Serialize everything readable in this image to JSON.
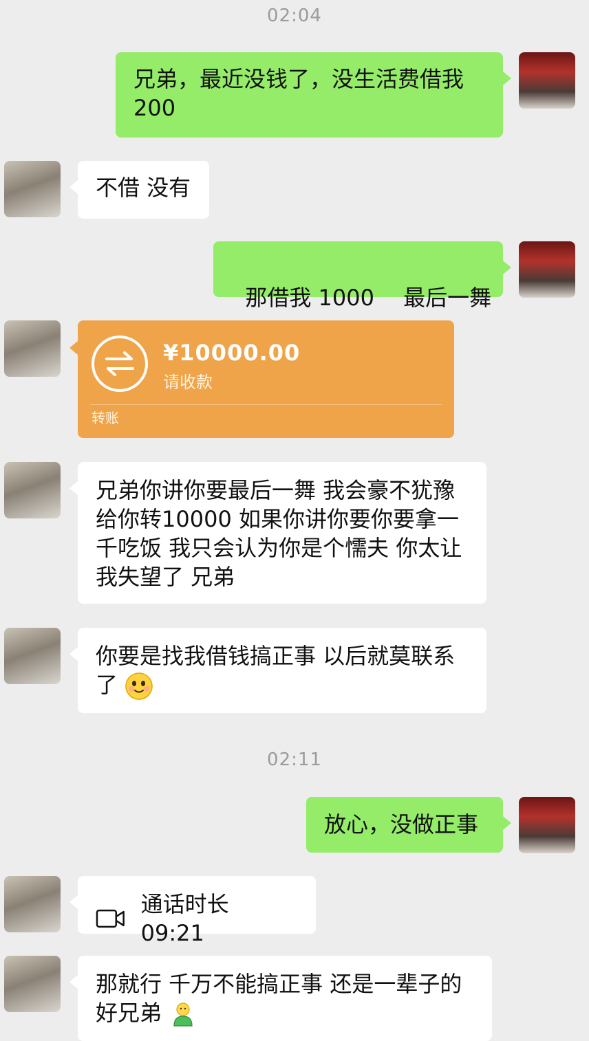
{
  "timestamps": [
    "02:04",
    "02:11"
  ],
  "messages": {
    "m1": "兄弟，最近没钱了，没生活费借我200",
    "m2": "不借 没有",
    "m3": "那借我 1000　 最后一舞",
    "transfer": {
      "amount": "¥10000.00",
      "status": "请收款",
      "label": "转账"
    },
    "m5": "兄弟你讲你要最后一舞 我会豪不犹豫给你转10000 如果你讲你要你要拿一千吃饭 我只会认为你是个懦夫 你太让我失望了 兄弟",
    "m6": "你要是找我借钱搞正事 以后就莫联系了",
    "m7": "放心，没做正事",
    "call": "通话时长 09:21",
    "m9": "那就行 千万不能搞正事 还是一辈子的好兄弟"
  },
  "icons": {
    "transfer": "transfer-arrows-icon",
    "call": "video-call-icon",
    "emoji1": "smiling-face-emoji",
    "emoji2": "green-figure-emoji"
  },
  "colors": {
    "me_bubble": "#95ec69",
    "friend_bubble": "#ffffff",
    "transfer": "#f0a44a",
    "background": "#ededed"
  }
}
